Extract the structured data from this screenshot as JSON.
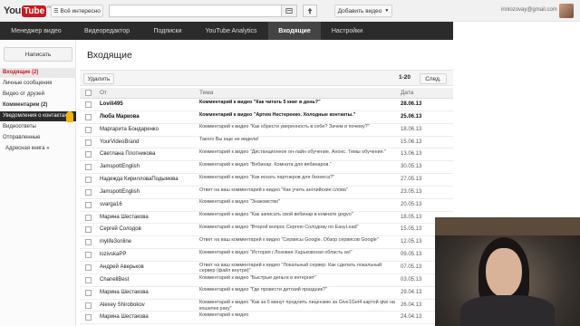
{
  "app": {
    "logo_you": "You",
    "logo_tube": "Tube",
    "logo_suffix": "RU"
  },
  "header": {
    "browse_button": "Всё интересно",
    "search_placeholder": "",
    "add_video_button": "Добавить видео",
    "username": "irinlozovay@gmail.com"
  },
  "nav": {
    "tabs": [
      {
        "label": "Менеджер видео"
      },
      {
        "label": "Видеоредактор"
      },
      {
        "label": "Подписки"
      },
      {
        "label": "YouTube Analytics"
      },
      {
        "label": "Входящие",
        "active": true
      },
      {
        "label": "Настройки"
      }
    ]
  },
  "sidebar": {
    "compose_button": "Написать",
    "items": [
      {
        "label": "Входящие (2)"
      },
      {
        "label": "Личные сообщения"
      },
      {
        "label": "Видео от друзей"
      },
      {
        "label": "Комментарии (2)"
      },
      {
        "label": "Уведомления о контактах"
      },
      {
        "label": "Видеоответы"
      },
      {
        "label": "Отправленные"
      },
      {
        "label": "Адресная книга »"
      }
    ]
  },
  "main": {
    "title": "Входящие",
    "delete_button": "Удалить",
    "pagination": "1-20",
    "next_button": "След.",
    "columns": {
      "from": "От",
      "topic": "Тема",
      "date": "Дата"
    },
    "rows": [
      {
        "from": "Lovili495",
        "topic": "Комментарий к видео \"Как читать 5 книг в день?\"",
        "date": "28.06.13",
        "unread": true
      },
      {
        "from": "Люба Маркова",
        "topic": "Комментарий к видео \"Артем Нестеренко. Холодные контакты.\"",
        "date": "25.06.13",
        "unread": true
      },
      {
        "from": "Маргарита Бондаренко",
        "topic": "Комментарий к видео \"Как обрести уверенность в себе? Зачем и почему?\"",
        "date": "18.06.13"
      },
      {
        "from": "YourVideoBrand",
        "topic": "Такого Вы еще не видели!",
        "date": "15.06.13"
      },
      {
        "from": "Светлана Плотникова",
        "topic": "Комментарий к видео \"Дистанционное он-лайн обучение. Анонс. Темы обучения.\"",
        "date": "13.06.13"
      },
      {
        "from": "JamspottEnglish",
        "topic": "Комментарий к видео \"Вебинар. Комната для вебинаров.\"",
        "date": "30.05.13"
      },
      {
        "from": "Надежда КирилловаПодымова",
        "topic": "Комментарий к видео \"Как искать партнеров для бизнеса?\"",
        "date": "27.05.13"
      },
      {
        "from": "JamspottEnglish",
        "topic": "Ответ на ваш комментарий к видео \"Как учить английские слова\"",
        "date": "23.05.13"
      },
      {
        "from": "svarga16",
        "topic": "Комментарий к видео \"Знакомство\"",
        "date": "20.05.13"
      },
      {
        "from": "Марина Шестакова",
        "topic": "Комментарий к видео \"Как записать свой вебинар в комнате gogvo\"",
        "date": "18.05.13"
      },
      {
        "from": "Сергей Солодов",
        "topic": "Комментарий к видео \"Второй вопрос Сергею Солодову по EasyLead\"",
        "date": "15.05.13"
      },
      {
        "from": "mylife3online",
        "topic": "Ответ на ваш комментарий к видео \"Сервисы Google. Обзор сервисов Google\"",
        "date": "12.05.13"
      },
      {
        "from": "lozivskaPP",
        "topic": "Комментарий к видео \"История г.Лозовая Харьковская область avi\"",
        "date": "09.05.13"
      },
      {
        "from": "Андрей Аверьков",
        "topic": "Ответ на ваш комментарий к видео \"Локальный сервер. Как сделать локальный сервер (файл внутри)\"",
        "date": "07.05.13"
      },
      {
        "from": "ChanellBest",
        "topic": "Комментарий к видео \"Быстрые деньги в интернет\"",
        "date": "03.05.13"
      },
      {
        "from": "Марина Шестакова",
        "topic": "Комментарий к видео \"Где провести детский праздник?\"",
        "date": "29.04.13"
      },
      {
        "from": "Alexey Shirobokov",
        "topic": "Комментарий к видео \"Как за 5 минут продлить лицензию за Give1Get4 картой qiwi на кошелек раку\"",
        "date": "26.04.13"
      },
      {
        "from": "Марина Шестакова",
        "topic": "Комментарий к видео",
        "date": "24.04.13"
      }
    ]
  },
  "colors": {
    "accent": "#cc181e",
    "nav_bg": "#2b2b2b"
  }
}
